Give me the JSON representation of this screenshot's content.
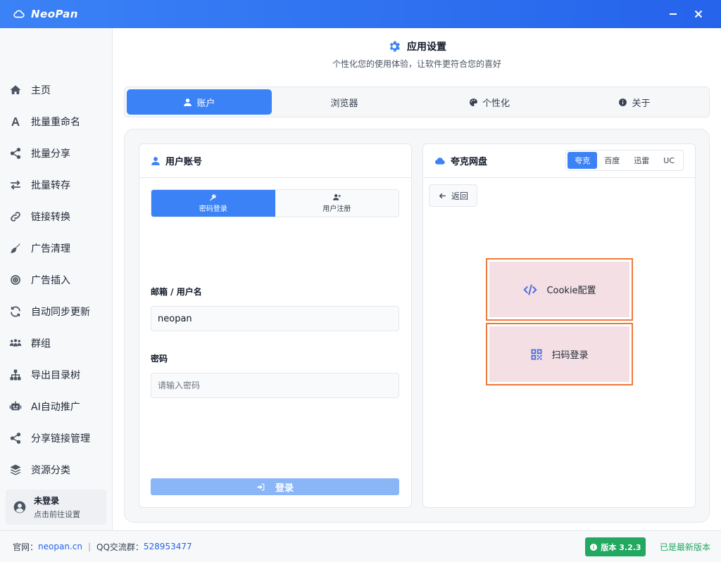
{
  "app": {
    "name": "NeoPan",
    "icons": {
      "logo": "cloud-icon",
      "minimize": "minimize-icon",
      "close": "close-icon"
    }
  },
  "colors": {
    "accent": "#3b82f6",
    "highlight_border": "#ee7a3c",
    "highlight_fill": "#f4dfe4",
    "success": "#22a860"
  },
  "sidebar": {
    "items": [
      {
        "label": "主页",
        "icon": "home-icon"
      },
      {
        "label": "批量重命名",
        "icon": "font-icon"
      },
      {
        "label": "批量分享",
        "icon": "share-icon"
      },
      {
        "label": "批量转存",
        "icon": "exchange-icon"
      },
      {
        "label": "链接转换",
        "icon": "link-icon"
      },
      {
        "label": "广告清理",
        "icon": "broom-icon"
      },
      {
        "label": "广告插入",
        "icon": "target-icon"
      },
      {
        "label": "自动同步更新",
        "icon": "sync-icon"
      },
      {
        "label": "群组",
        "icon": "group-icon"
      },
      {
        "label": "导出目录树",
        "icon": "sitemap-icon"
      },
      {
        "label": "AI自动推广",
        "icon": "robot-icon"
      },
      {
        "label": "分享链接管理",
        "icon": "share-alt-icon"
      },
      {
        "label": "资源分类",
        "icon": "layers-icon"
      }
    ],
    "user": {
      "name": "未登录",
      "hint": "点击前往设置"
    }
  },
  "header": {
    "title": "应用设置",
    "subtitle": "个性化您的使用体验，让软件更符合您的喜好"
  },
  "tabs": [
    {
      "label": "账户",
      "icon": "user-icon",
      "active": true
    },
    {
      "label": "浏览器",
      "icon": "",
      "active": false
    },
    {
      "label": "个性化",
      "icon": "palette-icon",
      "active": false
    },
    {
      "label": "关于",
      "icon": "info-icon",
      "active": false
    }
  ],
  "account": {
    "title": "用户账号",
    "modes": [
      {
        "label": "密码登录",
        "icon": "key-icon",
        "active": true
      },
      {
        "label": "用户注册",
        "icon": "user-plus-icon",
        "active": false
      }
    ],
    "username_label": "邮箱 / 用户名",
    "username_value": "neopan",
    "password_label": "密码",
    "password_placeholder": "请输入密码",
    "login_label": "登录"
  },
  "cloud": {
    "title": "夸克网盘",
    "providers": [
      {
        "label": "夸克",
        "active": true
      },
      {
        "label": "百度",
        "active": false
      },
      {
        "label": "迅雷",
        "active": false
      },
      {
        "label": "UC",
        "active": false
      }
    ],
    "back_label": "返回",
    "cookie_label": "Cookie配置",
    "qr_label": "扫码登录"
  },
  "footer": {
    "site_label": "官网：",
    "site_value": "neopan.cn",
    "qq_label": "QQ交流群：",
    "qq_value": "528953477",
    "version_label": "版本 3.2.3",
    "version_status": "已是最新版本"
  }
}
